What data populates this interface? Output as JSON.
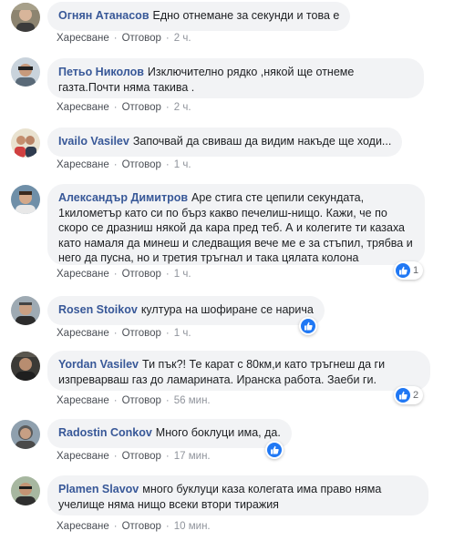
{
  "actions": {
    "like": "Харесване",
    "reply": "Отговор"
  },
  "comments": [
    {
      "author": "Огнян Атанасов",
      "text": "Едно отнемане за секунди и това е",
      "time": "2 ч.",
      "reactions": ""
    },
    {
      "author": "Петьо Николов",
      "text": "Изключително рядко ,някой ще отнеме газта.Почти няма такива .",
      "time": "2 ч.",
      "reactions": ""
    },
    {
      "author": "Ivailo Vasilev",
      "text": "Започвай да свиваш да видим накъде ще ходи...",
      "time": "1 ч.",
      "reactions": ""
    },
    {
      "author": "Александър Димитров",
      "text": "Аре стига сте цепили секундата, 1километър като си по бърз какво печелиш-нищо. Кажи, че по скоро се дразниш някой да кара пред теб. А и колегите ти казаха като намаля да минеш и следващия вече ме е за стъпил, трябва и него да пусна, но и третия тръгнал и така цялата колона",
      "time": "1 ч.",
      "reactions": "1"
    },
    {
      "author": "Rosen Stoikov",
      "text": "култура на шофиране се нарича",
      "time": "1 ч.",
      "reactions": ""
    },
    {
      "author": "Yordan Vasilev",
      "text": "Ти пък?! Те карат с 80км,и като тръгнеш да ги изпреварваш газ до ламарината. Иранска работа. Заеби ги.",
      "time": "56 мин.",
      "reactions": "2"
    },
    {
      "author": "Radostin Conkov",
      "text": "Много боклуци има, да.",
      "time": "17 мин.",
      "reactions": ""
    },
    {
      "author": "Plamen Slavov",
      "text": "много буклуци каза колегата има право няма учелище няма нищо всеки втори тиражия",
      "time": "10 мин.",
      "reactions": ""
    }
  ]
}
